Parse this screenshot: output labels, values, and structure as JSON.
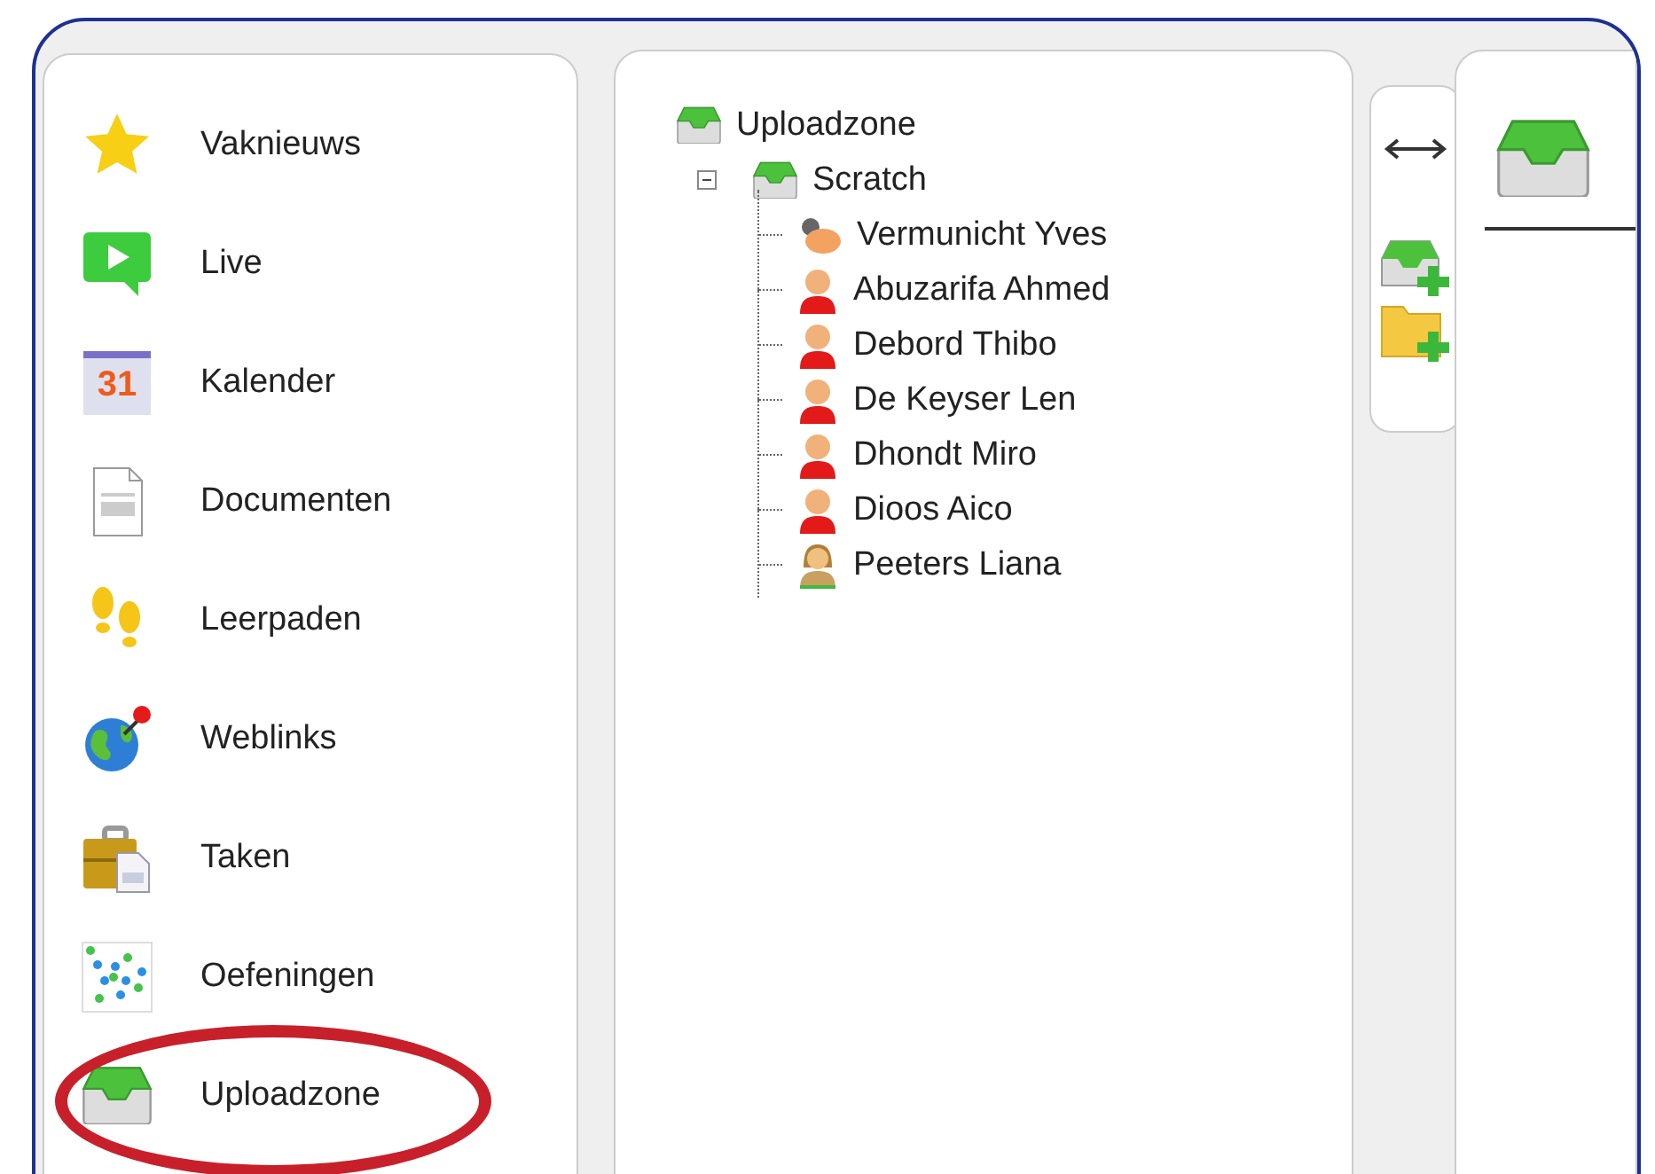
{
  "sidebar": {
    "items": [
      {
        "label": "Vaknieuws",
        "kind": "star",
        "circled": false
      },
      {
        "label": "Live",
        "kind": "live",
        "circled": false
      },
      {
        "label": "Kalender",
        "kind": "calendar",
        "icon_text": "31",
        "circled": false
      },
      {
        "label": "Documenten",
        "kind": "document",
        "circled": false
      },
      {
        "label": "Leerpaden",
        "kind": "footsteps",
        "circled": false
      },
      {
        "label": "Weblinks",
        "kind": "globe",
        "circled": false
      },
      {
        "label": "Taken",
        "kind": "briefcase",
        "circled": false
      },
      {
        "label": "Oefeningen",
        "kind": "dots",
        "circled": false
      },
      {
        "label": "Uploadzone",
        "kind": "inbox",
        "circled": true
      }
    ]
  },
  "tree": {
    "label": "Uploadzone",
    "kind": "inbox",
    "children": [
      {
        "label": "Scratch",
        "kind": "inbox",
        "expanded": true,
        "children": [
          {
            "label": "Vermunicht Yves",
            "kind": "group"
          },
          {
            "label": "Abuzarifa Ahmed",
            "kind": "male"
          },
          {
            "label": "Debord Thibo",
            "kind": "male"
          },
          {
            "label": "De Keyser Len",
            "kind": "male"
          },
          {
            "label": "Dhondt Miro",
            "kind": "male"
          },
          {
            "label": "Dioos Aico",
            "kind": "male"
          },
          {
            "label": "Peeters Liana",
            "kind": "female"
          }
        ]
      }
    ]
  }
}
